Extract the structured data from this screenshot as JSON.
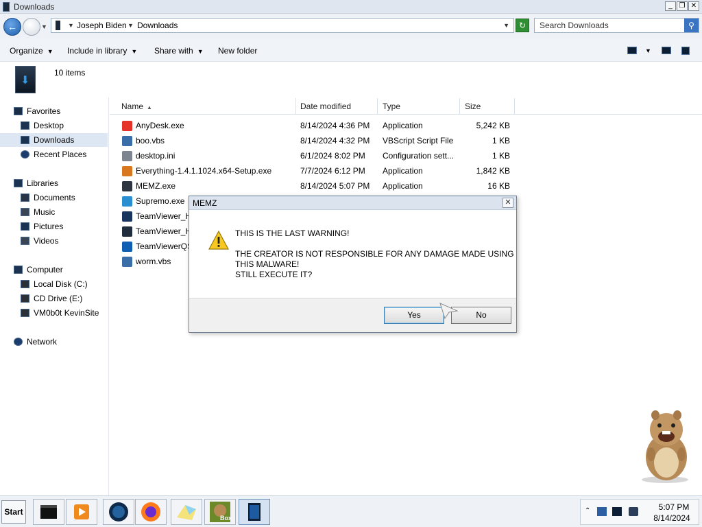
{
  "window": {
    "title": "Downloads"
  },
  "address": {
    "crumbs": [
      "Joseph Biden",
      "Downloads"
    ],
    "search_placeholder": "Search Downloads"
  },
  "toolbar": {
    "organize": "Organize",
    "include_in_library": "Include in library",
    "share_with": "Share with",
    "new_folder": "New folder"
  },
  "info": {
    "item_count": "10 items"
  },
  "nav": {
    "favorites": "Favorites",
    "desktop": "Desktop",
    "downloads": "Downloads",
    "recent_places": "Recent Places",
    "libraries": "Libraries",
    "documents": "Documents",
    "music": "Music",
    "pictures": "Pictures",
    "videos": "Videos",
    "computer": "Computer",
    "local_disk": "Local Disk (C:)",
    "cd_drive": "CD Drive (E:)",
    "vm_share": "VM0b0t KevinSite",
    "network": "Network"
  },
  "columns": {
    "name": "Name",
    "date": "Date modified",
    "type": "Type",
    "size": "Size"
  },
  "files": [
    {
      "name": "AnyDesk.exe",
      "date": "8/14/2024 4:36 PM",
      "type": "Application",
      "size": "5,242 KB",
      "icon": "anydesk-icon",
      "color": "#e5332a"
    },
    {
      "name": "boo.vbs",
      "date": "8/14/2024 4:32 PM",
      "type": "VBScript Script File",
      "size": "1 KB",
      "icon": "script-icon",
      "color": "#3a6ea8"
    },
    {
      "name": "desktop.ini",
      "date": "6/1/2024 8:02 PM",
      "type": "Configuration sett...",
      "size": "1 KB",
      "icon": "config-icon",
      "color": "#7d8590"
    },
    {
      "name": "Everything-1.4.1.1024.x64-Setup.exe",
      "date": "7/7/2024 6:12 PM",
      "type": "Application",
      "size": "1,842 KB",
      "icon": "magnifier-icon",
      "color": "#d9771e"
    },
    {
      "name": "MEMZ.exe",
      "date": "8/14/2024 5:07 PM",
      "type": "Application",
      "size": "16 KB",
      "icon": "app-icon",
      "color": "#2d3540"
    },
    {
      "name": "Supremo.exe",
      "icon": "supremo-icon",
      "color": "#2a8fd1"
    },
    {
      "name": "TeamViewer_H",
      "icon": "teamviewer-icon",
      "color": "#16365e"
    },
    {
      "name": "TeamViewer_H",
      "icon": "teamviewer-icon",
      "color": "#1f2d3d"
    },
    {
      "name": "TeamViewerQS",
      "icon": "teamviewer-qs-icon",
      "color": "#0e5fb4"
    },
    {
      "name": "worm.vbs",
      "icon": "script-icon",
      "color": "#3a6ea8"
    }
  ],
  "dialog": {
    "title": "MEMZ",
    "line1": "THIS IS THE LAST WARNING!",
    "line2": "THE CREATOR IS NOT RESPONSIBLE FOR ANY DAMAGE MADE USING",
    "line3": "THIS MALWARE!",
    "line4": "STILL EXECUTE IT?",
    "yes": "Yes",
    "no": "No"
  },
  "taskbar": {
    "start": "Start",
    "time": "5:07 PM",
    "date": "8/14/2024",
    "bonzi_label": "Box"
  }
}
